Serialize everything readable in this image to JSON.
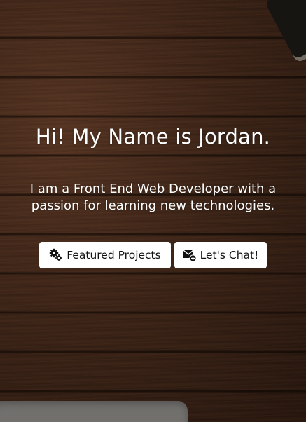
{
  "hero": {
    "heading": "Hi! My Name is Jordan.",
    "tagline": "I am a Front End Web Developer with a passion for learning new technologies."
  },
  "buttons": {
    "projects": {
      "label": "Featured Projects",
      "icon": "gears-icon"
    },
    "chat": {
      "label": "Let's Chat!",
      "icon": "mail-add-icon"
    }
  },
  "colors": {
    "button_bg": "#ffffff",
    "text_on_background": "#ffffff",
    "button_text": "#111111"
  }
}
